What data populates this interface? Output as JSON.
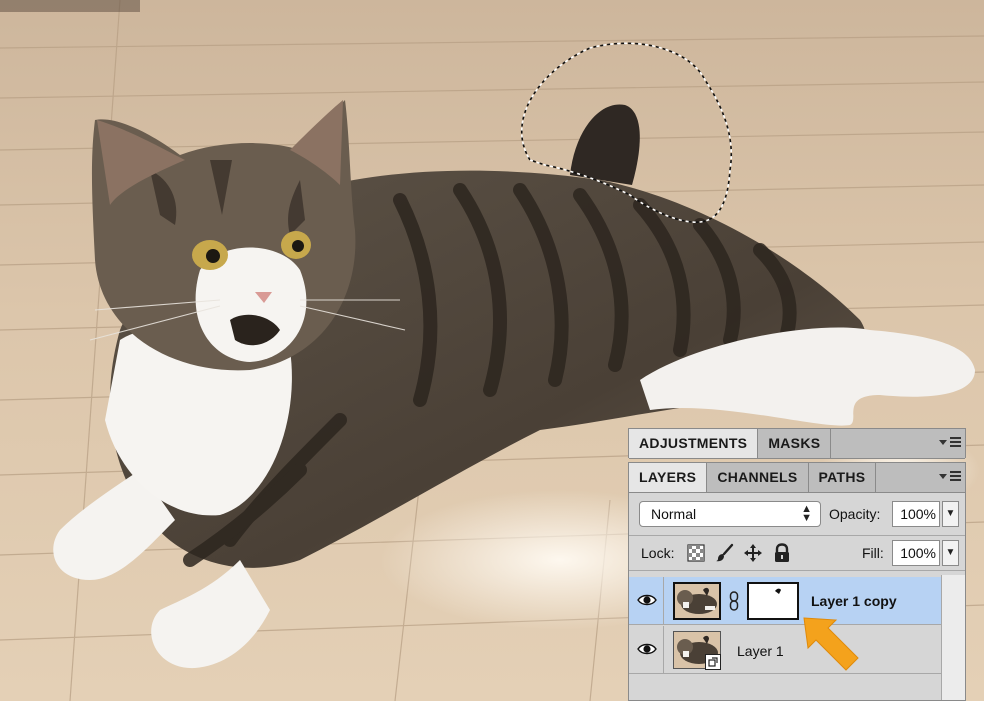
{
  "panels": {
    "top_tabs": [
      "ADJUSTMENTS",
      "MASKS"
    ],
    "layer_tabs": [
      "LAYERS",
      "CHANNELS",
      "PATHS"
    ]
  },
  "blend_mode": "Normal",
  "opacity": {
    "label": "Opacity:",
    "value": "100%"
  },
  "lock": {
    "label": "Lock:"
  },
  "fill": {
    "label": "Fill:",
    "value": "100%"
  },
  "layers": [
    {
      "name": "Layer 1 copy",
      "selected": true,
      "visible": true,
      "has_mask": true
    },
    {
      "name": "Layer 1",
      "selected": false,
      "visible": true,
      "has_mask": false
    }
  ],
  "colors": {
    "selection_highlight": "#b7d2f3",
    "callout_arrow": "#f4a21c",
    "panel_bg": "#d6d6d6"
  }
}
